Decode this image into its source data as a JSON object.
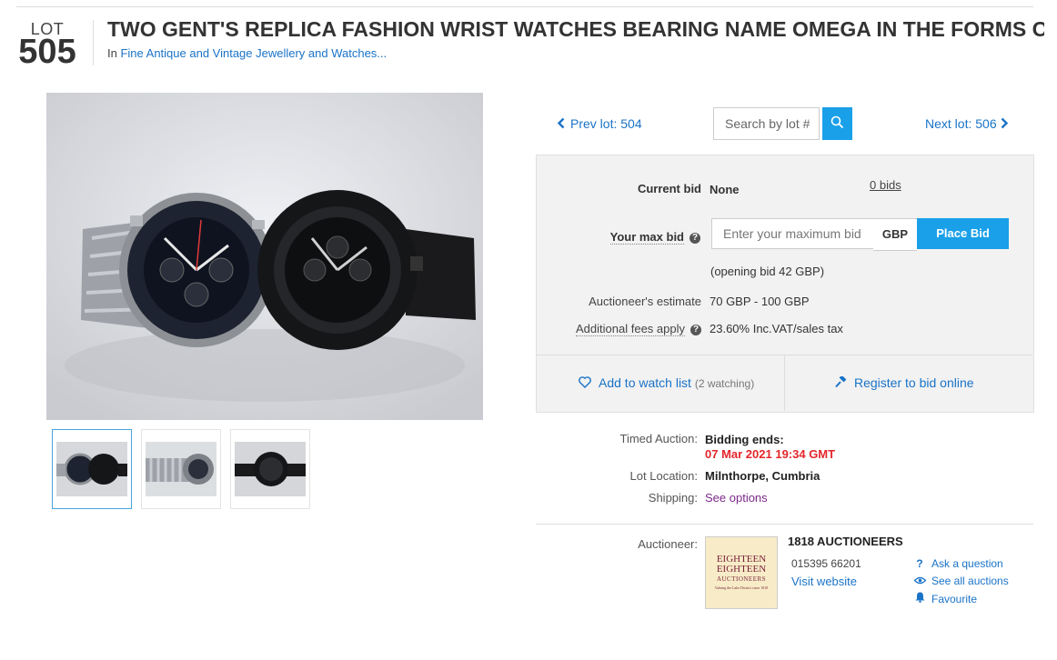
{
  "header": {
    "lot_label": "LOT",
    "lot_number": "505",
    "title": "TWO GENT'S REPLICA FASHION WRIST WATCHES BEARING NAME OMEGA IN THE FORMS OF",
    "category_prefix": "In",
    "category_link": "Fine Antique and Vintage Jewellery and Watches..."
  },
  "gallery": {
    "thumbnails": 3,
    "selected_index": 0
  },
  "nav": {
    "prev_label": "Prev lot: 504",
    "next_label": "Next lot: 506",
    "search_placeholder": "Search by lot #"
  },
  "bid": {
    "current_bid_label": "Current bid",
    "current_bid_value": "None",
    "bids_link": "0 bids",
    "max_bid_label": "Your max bid",
    "max_bid_placeholder": "Enter your maximum bid",
    "currency": "GBP",
    "place_bid_label": "Place Bid",
    "opening_bid": "(opening bid 42 GBP)",
    "estimate_label": "Auctioneer's estimate",
    "estimate_value": "70 GBP - 100 GBP",
    "fees_label": "Additional fees apply",
    "fees_value": "23.60% Inc.VAT/sales tax"
  },
  "actions": {
    "watch_label": "Add to watch list",
    "watch_count": "(2 watching)",
    "register_label": "Register to bid online"
  },
  "details": {
    "auction_type_label": "Timed Auction:",
    "bidding_ends_label": "Bidding ends:",
    "bidding_ends_value": "07 Mar 2021 19:34 GMT",
    "location_label": "Lot Location:",
    "location_value": "Milnthorpe, Cumbria",
    "shipping_label": "Shipping:",
    "shipping_value": "See options"
  },
  "auctioneer": {
    "label": "Auctioneer:",
    "logo_line1": "EIGHTEEN",
    "logo_line2": "EIGHTEEN",
    "logo_line3": "AUCTIONEERS",
    "logo_tagline": "Valuing the Lake District since 1818",
    "name": "1818 AUCTIONEERS",
    "phone": "015395 66201",
    "website": "Visit website",
    "ask_question": "Ask a question",
    "see_all": "See all auctions",
    "favourite": "Favourite"
  },
  "colors": {
    "link": "#1a73c7",
    "accent": "#1aa0e8",
    "danger": "#e4262c",
    "panel": "#f2f2f2"
  },
  "icons": [
    "chevron-left-icon",
    "chevron-right-icon",
    "search-icon",
    "help-icon",
    "heart-icon",
    "gavel-icon",
    "question-icon",
    "eye-icon",
    "bell-icon"
  ]
}
